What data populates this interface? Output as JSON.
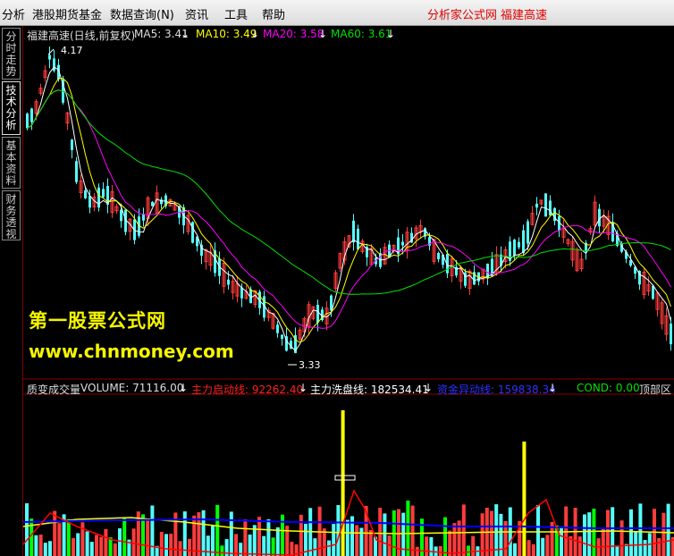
{
  "menu": {
    "items": [
      "分析",
      "港股期货基金",
      "数据查询(N)",
      "资讯",
      "工具",
      "帮助"
    ],
    "brand_left": "分析家公式网",
    "brand_right": "福建高速"
  },
  "side_tabs": [
    {
      "label": "分时走势",
      "active": false
    },
    {
      "label": "技术分析",
      "active": true
    },
    {
      "label": "基本资料",
      "active": false
    },
    {
      "label": "财务透视",
      "active": false
    }
  ],
  "price_panel": {
    "title": "福建高速(日线,前复权)",
    "ma5": "MA5: 3.41",
    "ma10": "MA10: 3.49",
    "ma20": "MA20: 3.58",
    "ma60": "MA60: 3.61",
    "high_label": "4.17",
    "low_label": "3.33"
  },
  "volume_panel": {
    "title": "质变成交量",
    "volume": "VOLUME: 71116.00",
    "line1": "主力启动线: 92262.40",
    "line2": "主力洗盘线: 182534.41",
    "line3": "资金异动线: 159838.34",
    "cond": "COND: 0.00",
    "top_zone": "顶部区"
  },
  "watermark": {
    "line1": "第一股票公式网",
    "line2": "www.chnmoney.com"
  },
  "colors": {
    "up": "#ff3c3c",
    "down": "#54fcfc",
    "ma5": "#ffffff",
    "ma10": "#ffff00",
    "ma20": "#ff00ff",
    "ma60": "#00e000",
    "vol_yellow": "#ffff00",
    "vol_green": "#00ff00",
    "vol_red_line": "#ff0000",
    "vol_blue_line": "#0000ff"
  },
  "chart_data": {
    "type": "candlestick",
    "price_high": 4.17,
    "price_low": 3.33
  }
}
